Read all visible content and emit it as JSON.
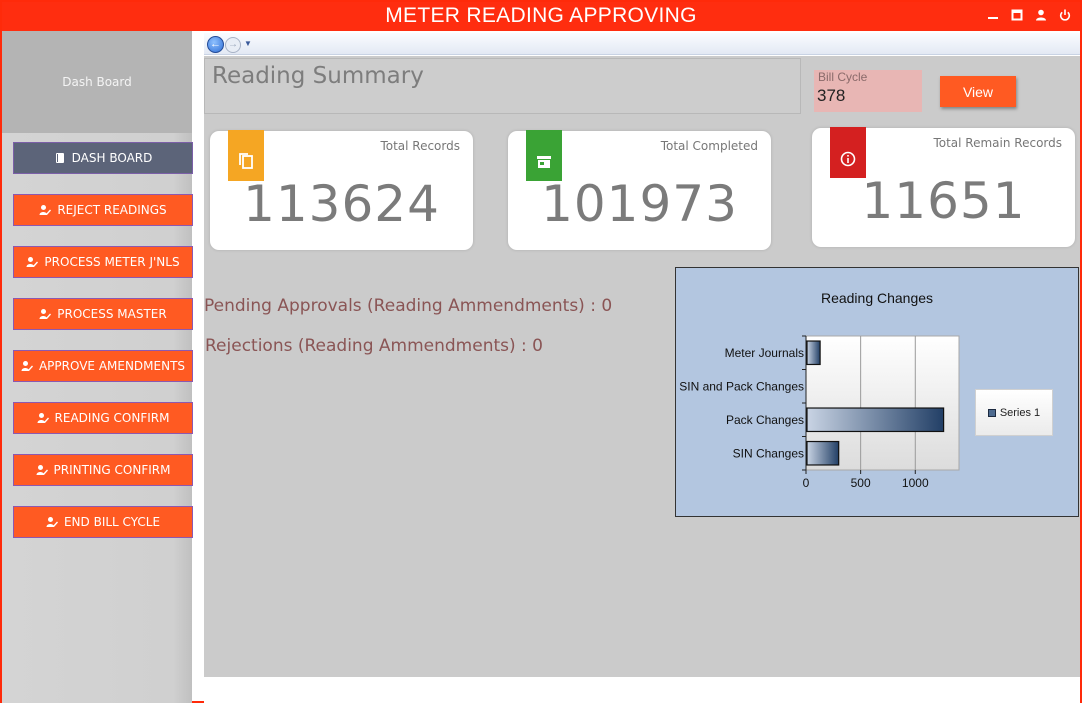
{
  "window": {
    "title": "METER READING APPROVING"
  },
  "sidebar": {
    "header": "Dash Board",
    "items": [
      {
        "label": "DASH BOARD",
        "active": true,
        "icon": "book-icon"
      },
      {
        "label": "REJECT READINGS",
        "active": false,
        "icon": "user-edit-icon"
      },
      {
        "label": "PROCESS METER J'NLS",
        "active": false,
        "icon": "user-edit-icon"
      },
      {
        "label": "PROCESS MASTER",
        "active": false,
        "icon": "user-edit-icon"
      },
      {
        "label": "APPROVE AMENDMENTS",
        "active": false,
        "icon": "user-edit-icon"
      },
      {
        "label": "READING CONFIRM",
        "active": false,
        "icon": "user-edit-icon"
      },
      {
        "label": "PRINTING CONFIRM",
        "active": false,
        "icon": "user-edit-icon"
      },
      {
        "label": "END BILL CYCLE",
        "active": false,
        "icon": "user-edit-icon"
      }
    ]
  },
  "main": {
    "summary_title": "Reading Summary",
    "bill_cycle": {
      "label": "Bill Cycle",
      "value": "378"
    },
    "view_button": "View",
    "cards": [
      {
        "label": "Total Records",
        "value": "113624",
        "color": "#f5a623",
        "icon": "copy-icon"
      },
      {
        "label": "Total Completed",
        "value": "101973",
        "color": "#3aa335",
        "icon": "store-icon"
      },
      {
        "label": "Total Remain Records",
        "value": "11651",
        "color": "#d42020",
        "icon": "info-icon"
      }
    ],
    "pending_text": "Pending Approvals (Reading Ammendments) : 0",
    "rejections_text": "Rejections (Reading Ammendments) : 0"
  },
  "colors": {
    "titlebar": "#ff2d0f",
    "nav_button": "#ff5a22",
    "nav_active": "#5c6479",
    "chart_panel": "#b3c6e0"
  },
  "chart_data": {
    "type": "bar",
    "orientation": "horizontal",
    "title": "Reading Changes",
    "categories": [
      "Meter Journals",
      "SIN and Pack Changes",
      "Pack Changes",
      "SIN Changes"
    ],
    "series": [
      {
        "name": "Series 1",
        "values": [
          120,
          0,
          1250,
          290
        ]
      }
    ],
    "xlim": [
      0,
      1400
    ],
    "xticks": [
      0,
      500,
      1000
    ],
    "xlabel": "",
    "ylabel": "",
    "grid": true,
    "legend": "right"
  }
}
